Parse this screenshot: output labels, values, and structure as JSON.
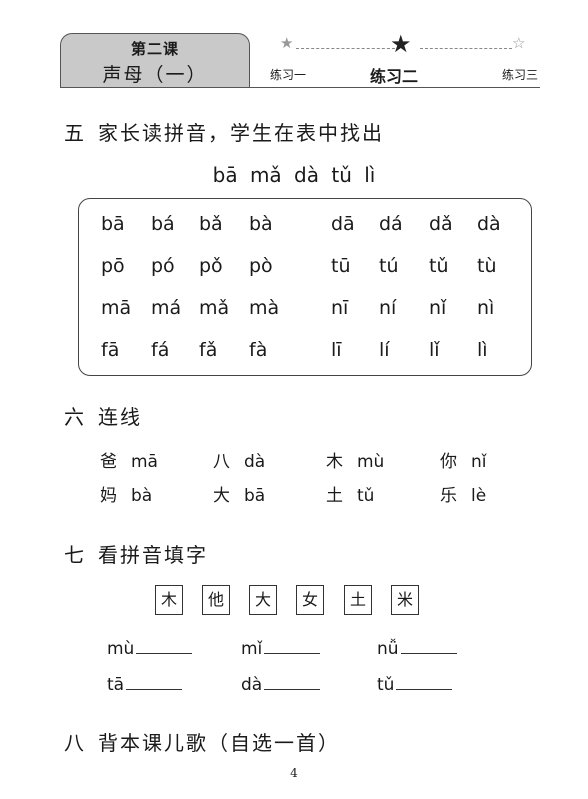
{
  "header": {
    "lesson_number": "第二课",
    "lesson_name": "声母（一）",
    "exercises": [
      "练习一",
      "练习二",
      "练习三"
    ],
    "current_exercise_index": 1
  },
  "section5": {
    "number": "五",
    "title": "家长读拼音，学生在表中找出",
    "target_pinyin": "bā mǎ dà tǔ lì",
    "table_rows": [
      [
        "bā",
        "bá",
        "bǎ",
        "bà",
        "dā",
        "dá",
        "dǎ",
        "dà"
      ],
      [
        "pō",
        "pó",
        "pǒ",
        "pò",
        "tū",
        "tú",
        "tǔ",
        "tù"
      ],
      [
        "mā",
        "má",
        "mǎ",
        "mà",
        "nī",
        "ní",
        "nǐ",
        "nì"
      ],
      [
        "fā",
        "fá",
        "fǎ",
        "fà",
        "lī",
        "lí",
        "lǐ",
        "lì"
      ]
    ]
  },
  "section6": {
    "number": "六",
    "title": "连线",
    "row1": [
      {
        "char": "爸",
        "pinyin": "mā"
      },
      {
        "char": "八",
        "pinyin": "dà"
      },
      {
        "char": "木",
        "pinyin": "mù"
      },
      {
        "char": "你",
        "pinyin": "nǐ"
      }
    ],
    "row2": [
      {
        "char": "妈",
        "pinyin": "bà"
      },
      {
        "char": "大",
        "pinyin": "bā"
      },
      {
        "char": "土",
        "pinyin": "tǔ"
      },
      {
        "char": "乐",
        "pinyin": "lè"
      }
    ]
  },
  "section7": {
    "number": "七",
    "title": "看拼音填字",
    "characters": [
      "木",
      "他",
      "大",
      "女",
      "土",
      "米"
    ],
    "blanks_row1": [
      "mù",
      "mǐ",
      "nǚ"
    ],
    "blanks_row2": [
      "tā",
      "dà",
      "tǔ"
    ]
  },
  "section8": {
    "number": "八",
    "title": "背本课儿歌（自选一首）"
  },
  "page_number": "4"
}
